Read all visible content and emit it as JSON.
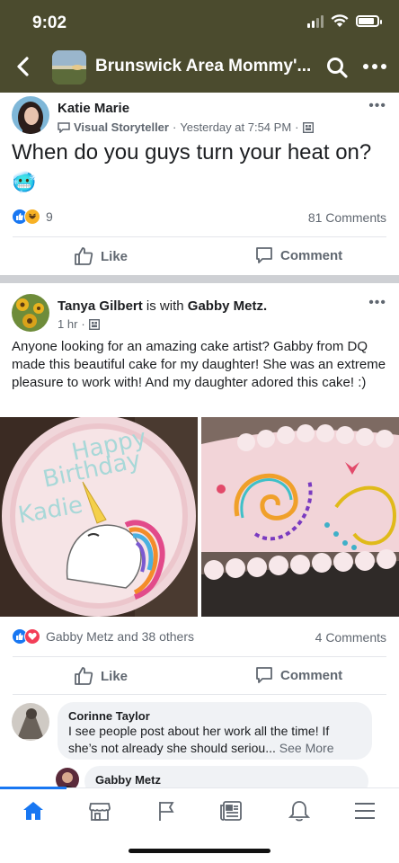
{
  "status_bar": {
    "time": "9:02",
    "battery_level": 0.85
  },
  "header": {
    "group_name": "Brunswick Area Mommy'...",
    "icons": [
      "back-icon",
      "search-icon",
      "more-icon"
    ]
  },
  "post1": {
    "author": "Katie Marie",
    "badge": "Visual Storyteller",
    "time": "Yesterday at 7:54 PM",
    "text": "When do you guys turn your heat on?",
    "emoji": "🥶",
    "reaction_count": "9",
    "comments": "81 Comments",
    "like_label": "Like",
    "comment_label": "Comment"
  },
  "post2": {
    "author": "Tanya Gilbert",
    "with_text": "is with",
    "tagged": "Gabby Metz",
    "time": "1 hr",
    "text": "Anyone looking for an amazing cake artist?  Gabby from DQ made this beautiful cake for my daughter! She was an extreme pleasure to work with! And my daughter adored this cake! :)",
    "cake_text": [
      "Happy",
      "Birthday",
      "Kadie"
    ],
    "reactions_text": "Gabby Metz and 38 others",
    "comments": "4 Comments",
    "like_label": "Like",
    "comment_label": "Comment"
  },
  "comments": [
    {
      "name": "Corinne Taylor",
      "text": "I see people post about her work all the time! If she’s not already she should seriou... ",
      "see_more": "See More"
    },
    {
      "name": "Gabby Metz"
    }
  ],
  "bottom_nav": [
    "home-icon",
    "marketplace-icon",
    "pages-icon",
    "news-icon",
    "notifications-icon",
    "menu-icon"
  ],
  "colors": {
    "header_bg": "#4b4b2e",
    "accent": "#1877f2",
    "like_blue": "#1877f2",
    "love_red": "#f33e58"
  }
}
